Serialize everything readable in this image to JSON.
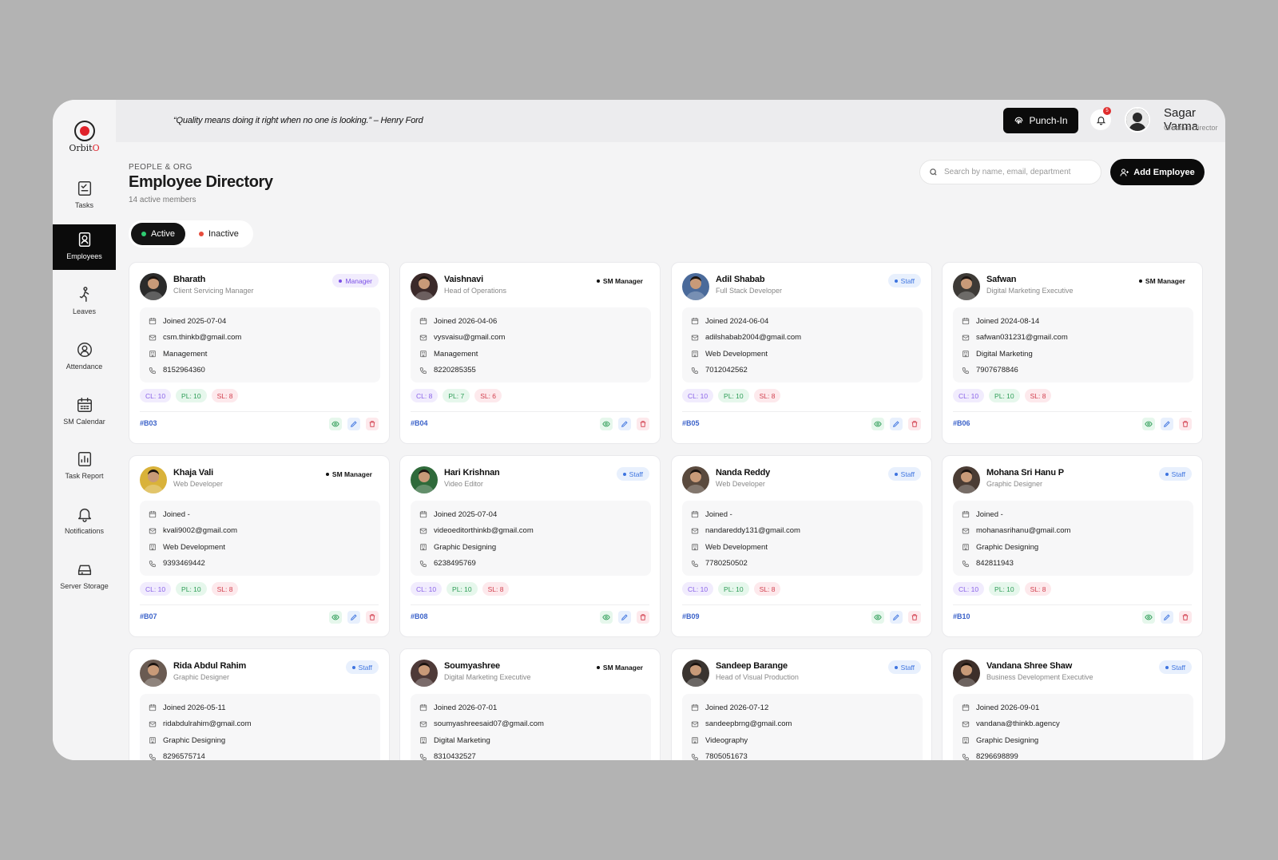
{
  "app": {
    "logo_text": "Orbit",
    "logo_accent": "O"
  },
  "quote": "“Quality means doing it right when no one is looking.” – Henry Ford",
  "nav": [
    {
      "label": "Tasks",
      "icon": "tasks-icon"
    },
    {
      "label": "Employees",
      "icon": "employees-icon",
      "active": true
    },
    {
      "label": "Leaves",
      "icon": "leaves-icon"
    },
    {
      "label": "Attendance",
      "icon": "attendance-icon"
    },
    {
      "label": "SM Calendar",
      "icon": "calendar-icon"
    },
    {
      "label": "Task Report",
      "icon": "report-icon"
    },
    {
      "label": "Notifications",
      "icon": "bell-icon"
    },
    {
      "label": "Server Storage",
      "icon": "storage-icon"
    }
  ],
  "topbar": {
    "punch_label": "Punch-In",
    "notification_count": "5",
    "user_name": "Sagar Varma",
    "user_role": "Creative Director"
  },
  "header": {
    "breadcrumb": "PEOPLE & ORG",
    "title": "Employee Directory",
    "subtitle": "14 active members",
    "search_placeholder": "Search by name, email, department",
    "add_label": "Add Employee"
  },
  "tabs": [
    {
      "label": "Active",
      "dot_color": "#2ecc71",
      "active": true
    },
    {
      "label": "Inactive",
      "dot_color": "#e74c3c",
      "active": false
    }
  ],
  "colors": {
    "accent": "#0b0b0b",
    "brand_red": "#e0222b",
    "id_blue": "#3b62c9"
  },
  "employees": [
    {
      "name": "Bharath",
      "role": "Client Servicing Manager",
      "badge": "Manager",
      "badge_type": "manager",
      "joined": "Joined 2025-07-04",
      "email": "csm.thinkb@gmail.com",
      "department": "Management",
      "phone": "8152964360",
      "cl": "CL: 10",
      "pl": "PL: 10",
      "sl": "SL: 8",
      "id": "#B03",
      "avatar_bg": "#2b2b2b"
    },
    {
      "name": "Vaishnavi",
      "role": "Head of Operations",
      "badge": "SM Manager",
      "badge_type": "sm",
      "joined": "Joined 2026-04-06",
      "email": "vysvaisu@gmail.com",
      "department": "Management",
      "phone": "8220285355",
      "cl": "CL: 8",
      "pl": "PL: 7",
      "sl": "SL: 6",
      "id": "#B04",
      "avatar_bg": "#3b2a2a"
    },
    {
      "name": "Adil Shabab",
      "role": "Full Stack Developer",
      "badge": "Staff",
      "badge_type": "staff",
      "joined": "Joined 2024-06-04",
      "email": "adilshabab2004@gmail.com",
      "department": "Web Development",
      "phone": "7012042562",
      "cl": "CL: 10",
      "pl": "PL: 10",
      "sl": "SL: 8",
      "id": "#B05",
      "avatar_bg": "#4a6a9a"
    },
    {
      "name": "Safwan",
      "role": "Digital Marketing Executive",
      "badge": "SM Manager",
      "badge_type": "sm",
      "joined": "Joined 2024-08-14",
      "email": "safwan031231@gmail.com",
      "department": "Digital Marketing",
      "phone": "7907678846",
      "cl": "CL: 10",
      "pl": "PL: 10",
      "sl": "SL: 8",
      "id": "#B06",
      "avatar_bg": "#3d3a36"
    },
    {
      "name": "Khaja Vali",
      "role": "Web Developer",
      "badge": "SM Manager",
      "badge_type": "sm",
      "joined": "Joined -",
      "email": "kvali9002@gmail.com",
      "department": "Web Development",
      "phone": "9393469442",
      "cl": "CL: 10",
      "pl": "PL: 10",
      "sl": "SL: 8",
      "id": "#B07",
      "avatar_bg": "#d9b23a"
    },
    {
      "name": "Hari Krishnan",
      "role": "Video Editor",
      "badge": "Staff",
      "badge_type": "staff",
      "joined": "Joined 2025-07-04",
      "email": "videoeditorthinkb@gmail.com",
      "department": "Graphic Designing",
      "phone": "6238495769",
      "cl": "CL: 10",
      "pl": "PL: 10",
      "sl": "SL: 8",
      "id": "#B08",
      "avatar_bg": "#2f6a3a"
    },
    {
      "name": "Nanda Reddy",
      "role": "Web Developer",
      "badge": "Staff",
      "badge_type": "staff",
      "joined": "Joined -",
      "email": "nandareddy131@gmail.com",
      "department": "Web Development",
      "phone": "7780250502",
      "cl": "CL: 10",
      "pl": "PL: 10",
      "sl": "SL: 8",
      "id": "#B09",
      "avatar_bg": "#5a4a3e"
    },
    {
      "name": "Mohana Sri Hanu P",
      "role": "Graphic Designer",
      "badge": "Staff",
      "badge_type": "staff",
      "joined": "Joined -",
      "email": "mohanasrihanu@gmail.com",
      "department": "Graphic Designing",
      "phone": "842811943",
      "cl": "CL: 10",
      "pl": "PL: 10",
      "sl": "SL: 8",
      "id": "#B10",
      "avatar_bg": "#4a3c34"
    },
    {
      "name": "Rida Abdul Rahim",
      "role": "Graphic Designer",
      "badge": "Staff",
      "badge_type": "staff",
      "joined": "Joined 2026-05-11",
      "email": "ridabdulrahim@gmail.com",
      "department": "Graphic Designing",
      "phone": "8296575714",
      "cl": "",
      "pl": "",
      "sl": "",
      "id": "",
      "avatar_bg": "#6a5b52"
    },
    {
      "name": "Soumyashree",
      "role": "Digital Marketing Executive",
      "badge": "SM Manager",
      "badge_type": "sm",
      "joined": "Joined 2026-07-01",
      "email": "soumyashreesaid07@gmail.com",
      "department": "Digital Marketing",
      "phone": "8310432527",
      "cl": "",
      "pl": "",
      "sl": "",
      "id": "",
      "avatar_bg": "#4e3a38"
    },
    {
      "name": "Sandeep Barange",
      "role": "Head of Visual Production",
      "badge": "Staff",
      "badge_type": "staff",
      "joined": "Joined 2026-07-12",
      "email": "sandeepbrng@gmail.com",
      "department": "Videography",
      "phone": "7805051673",
      "cl": "",
      "pl": "",
      "sl": "",
      "id": "",
      "avatar_bg": "#3a3430"
    },
    {
      "name": "Vandana Shree Shaw",
      "role": "Business Development Executive",
      "badge": "Staff",
      "badge_type": "staff",
      "joined": "Joined 2026-09-01",
      "email": "vandana@thinkb.agency",
      "department": "Graphic Designing",
      "phone": "8296698899",
      "cl": "",
      "pl": "",
      "sl": "",
      "id": "",
      "avatar_bg": "#3d2f2a"
    }
  ]
}
